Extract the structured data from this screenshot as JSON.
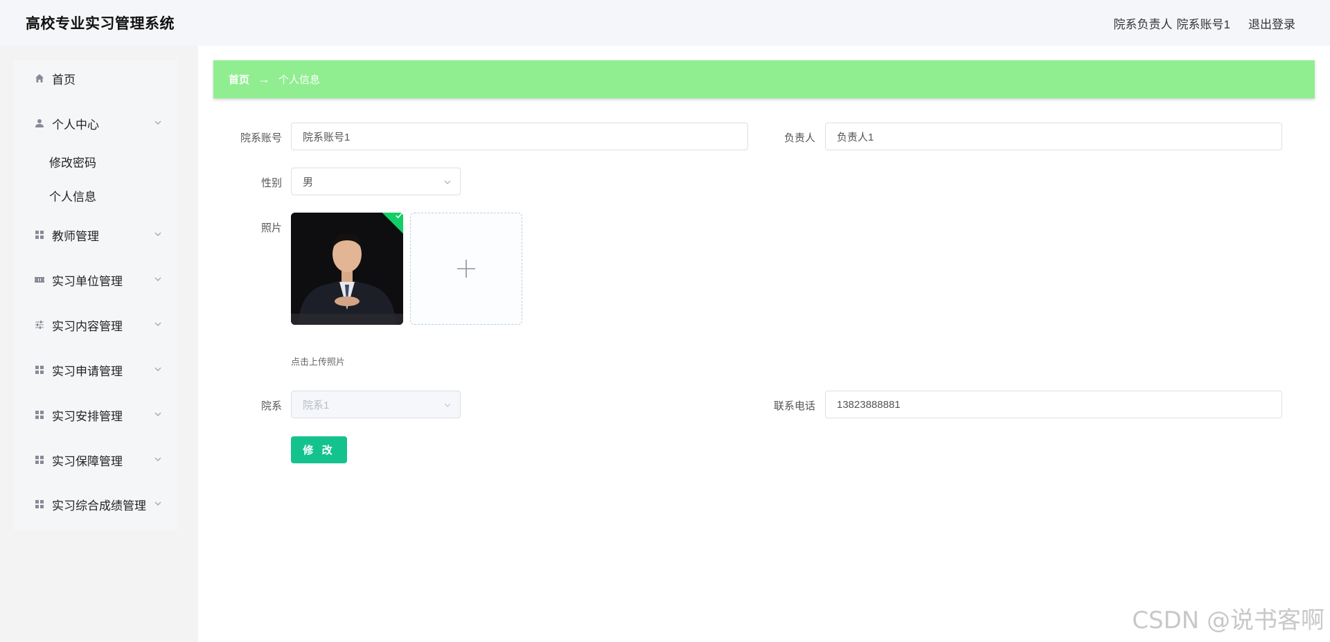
{
  "header": {
    "title": "高校专业实习管理系统",
    "user_role": "院系负责人",
    "user_account": "院系账号1",
    "logout_label": "退出登录"
  },
  "sidebar": {
    "home": "首页",
    "personal_center": "个人中心",
    "personal_sub": [
      "修改密码",
      "个人信息"
    ],
    "items": [
      "教师管理",
      "实习单位管理",
      "实习内容管理",
      "实习申请管理",
      "实习安排管理",
      "实习保障管理",
      "实习综合成绩管理"
    ]
  },
  "breadcrumb": {
    "home": "首页",
    "separator": "→",
    "current": "个人信息"
  },
  "form": {
    "account_label": "院系账号",
    "account_value": "院系账号1",
    "manager_label": "负责人",
    "manager_value": "负责人1",
    "gender_label": "性别",
    "gender_value": "男",
    "photo_label": "照片",
    "upload_hint": "点击上传照片",
    "department_label": "院系",
    "department_value": "院系1",
    "phone_label": "联系电话",
    "phone_value": "13823888881",
    "submit_label": "修 改"
  },
  "watermark": "CSDN @说书客啊",
  "colors": {
    "breadcrumb_bg": "#90ee90",
    "primary_button": "#14c28e",
    "success_badge": "#13ce66"
  }
}
